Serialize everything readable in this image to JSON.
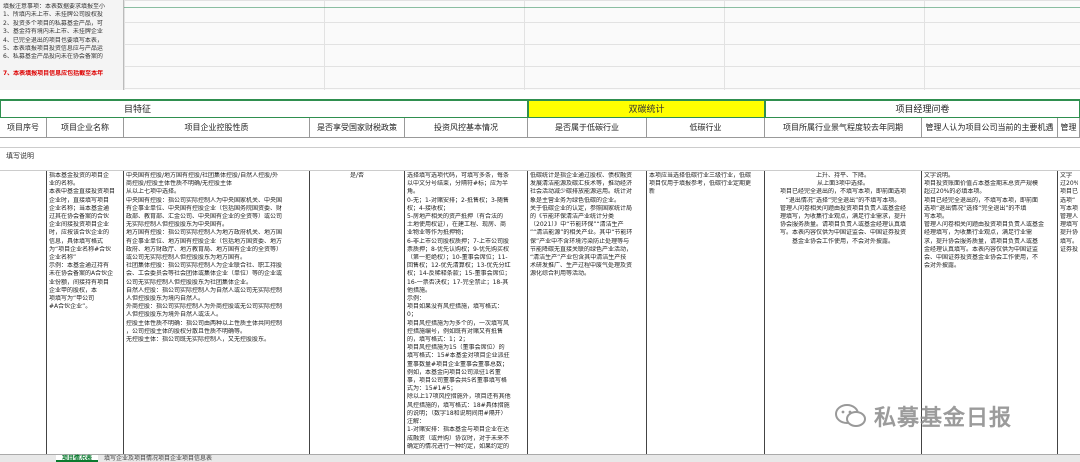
{
  "notes": [
    "填报注意事项：本表数据要求填报至小",
    "1、所填内未上市、未挂牌公司股权投",
    "2、投资多个项目的私募基金产品，可",
    "3、基金持有境内未上市、未挂牌企业",
    "4、已完全退出的项目也要填写本表，",
    "5、本表填报项目投资信息应与产品运",
    "6、私募基金产品投向未在协会备案的",
    "",
    "7、本表填报项目信息应包括截至本年"
  ],
  "groups": {
    "g1": "目特征",
    "g2": "双碳统计",
    "g3": "项目经理问卷"
  },
  "headers": [
    "项目序号",
    "项目企业名称",
    "项目企业控股性质",
    "是否享受国家财税政策",
    "投资风控基本情况",
    "是否属于低碳行业",
    "低碳行业",
    "项目所属行业景气程度较去年同期",
    "管理人认为项目公司当前的主要机遇",
    "管理"
  ],
  "fill_label": "填写说明",
  "col_name": [
    "指本基金投资的项目企",
    "业的名称。",
    "本表中基金直接投资项目",
    "企业时，直接填写项目",
    "企业名称；当本基金通",
    "过其在协会备案的合伙",
    "企业间接投资项目企业",
    "时，应按该合伙企业的",
    "信息，具体填写格式",
    "为“项目企业名称#合伙",
    "企业名称”",
    "示例：本基金通过持有",
    "未在协会备案的A合伙企",
    "业份额，间接持有项目",
    "企业甲的股权，本",
    "项填写为“甲公司",
    "#A合伙企业”。"
  ],
  "col_control": [
    "中央国有控股/地方国有控股/社团集体控股/自然人控股/外",
    "商控股/控股主体性质不明确/无控股主体",
    "从以上七项中选择。",
    "中央国有控股：指公司实际控制人为中央国家机关、中央国",
    "有企事业单位、中央国有控股企业（包括国务院国资委、财",
    "政部、教育部、汇金公司、中央国有企业的全资等）或公司",
    "无实际控制人但控股股东为中央国有。",
    "地方国有控股：指公司实际控制人为地方政府机关、地方国",
    "有企事业单位、地方国有控股企业（包括地方国资委、地方",
    "政府、地方财政厅、地方教育局、地方国有企业的全资等）",
    "或公司无实际控制人但控股股东为地方国有。",
    "社团集体控股：指公司实际控制人为企业联合社、职工持股",
    "会、工会委员会等社会团体或集体企业（单位）等的企业或",
    "公司无实际控制人但控股股东为社团集体企业。",
    "自然人控股：指公司实际控制人为自然人或公司无实际控制",
    "人但控股股东为境内自然人。",
    "外商控股：指公司实际控制人为外商控股或无公司实际控制",
    "人但控股股东为境外自然人或法人。",
    "控股主体性质不明确：指公司由两种以上性质主体共同控制",
    "，公司控股主体的股权分散且性质不明确等。",
    "无控股主体：指公司既无实际控制人，又无控股股东。"
  ],
  "col_tax": [
    "是/否"
  ],
  "col_risk": [
    "选择填写选项代码，可填写多条，每条",
    "以中文分号结束，分隔符#标；应为半",
    "角。",
    "0-无；1-对赌安排；2-抵售权；3-随售",
    "权；4-接收权；",
    "5-房地产相关的资产抵押（有合法的",
    "土地使用权证），在建工程、现房、商",
    "业物业等作为抵押物；",
    "6-非上市公司股权质押；7-上市公司股",
    "票质押；8-优先认购权；9-优先购买权",
    "（第一拒绝权）；10-董事会席位；11-",
    "回售权；12-优先清算权；13-优先分红",
    "权；14-反稀释条款；15-董事会席位；",
    "16-一票否决权；17-完全禁止；18-其",
    "他措施。",
    "示例：",
    "项目如果没有风控措施，填写格式：",
    "0；",
    "项目风控措施为为多个的，一次填写风",
    "控措施编号，例如既有对赌又有抵售",
    "的，填写格式：1；2；",
    "项目风控措施为15（董事会席位）的",
    "填写格式：15#本基金对项目企业派驻",
    "董事数量#项目企业董事会董事总数；",
    "例如，本基金向项目公司派驻1名董",
    "事，项目公司董事会共5名董事填写格",
    "式为：15#1#5；",
    "除以上17项风控措施外，项目还有其他",
    "风控措施的，填写格式：18#具体措施",
    "的说明；（数字18和说明间用#隔开）",
    "注解：",
    "1-对赌安排：指本基金与项目企业在达",
    "成融资（或并购）协议时，对于未来不",
    "确定的情况进行一种约定，如果约定的"
  ],
  "col_lowcarbon": [
    "低碳统计是指企业通过股权、债权融资",
    "发展清洁能源及碳汇技术等，推动经济",
    "社会活动减少碳排放能源运用。统计对",
    "象是主营业务为绿色低碳的企业。",
    "关于低碳企业的认定，参照国家统计局",
    "的《节能环保清洁产业统计分类",
    "（2021）》中“节能环保”“清洁生产",
    "”“清洁能源”的相关产业。其中“节能环",
    "保”产业中不含环境污染防止处理等与",
    "节能降碳无直接关联的绿色产业活动，",
    "“清洁生产”产业包含其中清洁生产技",
    "术研发推广、生产过程中废气处理及资",
    "源化综合利用等活动。"
  ],
  "col_lowcarbon_ind": [
    "本项应当选择低碳行业三级行业，低碳",
    "项目仅用于填报参考，低碳行业定期更",
    "新"
  ],
  "col_industry": [
    "上升、持平、下降。",
    "从上面3项中选择。",
    "项目已经完全退出的，不填写本项，即前面选项",
    "“退出情况”选择“完全退出”的不填写本项。",
    "管理人问卷相关问题由投资项目负责人或基金经",
    "理填写，为收集行业观点，满足行业需求，提升",
    "协会服务质量。请项目负责人或基金经理认真填",
    "写。本表内容仅供为中国证监会、中国证券投资",
    "基金业协会工作使用，不会对外披露。"
  ],
  "col_opportunity": [
    "文字说明。",
    "项目投资账面价值占本基金期末总资产规模",
    "超过20%的必填本项。",
    "项目已经完全退出的，不填写本项，即前面",
    "选项“退出情况”选择“完全退出”的不填",
    "写本项。",
    "管理人问卷相关问题由投资项目负责人或基金",
    "经理填写，为收集行业观点，满足行业需",
    "求，提升协会服务质量，请项目负责人或基",
    "金经理认真填写。本表内容仅供为中国证监",
    "会、中国证券投资基金业协会工作使用，不",
    "会对外披露。"
  ],
  "col_last": [
    "文字",
    "过20%",
    "项目已",
    "选项“",
    "写本项",
    "管理人",
    "理填写",
    "提升协",
    "填写。",
    "证券投"
  ],
  "watermark": "私募基金日报",
  "tabs": [
    "项目情况表",
    "填写企业及项目情况项目企业项目信息表"
  ]
}
